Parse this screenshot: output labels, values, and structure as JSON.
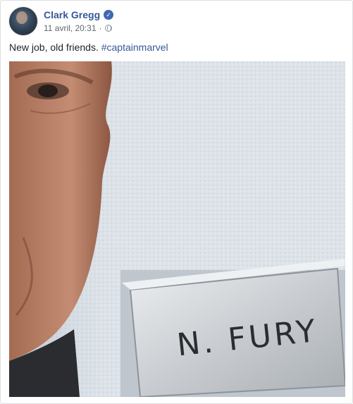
{
  "post": {
    "author": "Clark Gregg",
    "verified_icon": "verified-badge-icon",
    "timestamp": "11 avril, 20:31",
    "separator": "·",
    "privacy_icon": "globe-icon",
    "text": "New job, old friends.",
    "hashtag": "#captainmarvel"
  },
  "photo": {
    "name_plate_text": "N. FURY"
  },
  "colors": {
    "link": "#365899",
    "text": "#1d2129",
    "meta": "#616770",
    "verified": "#4267b2"
  }
}
